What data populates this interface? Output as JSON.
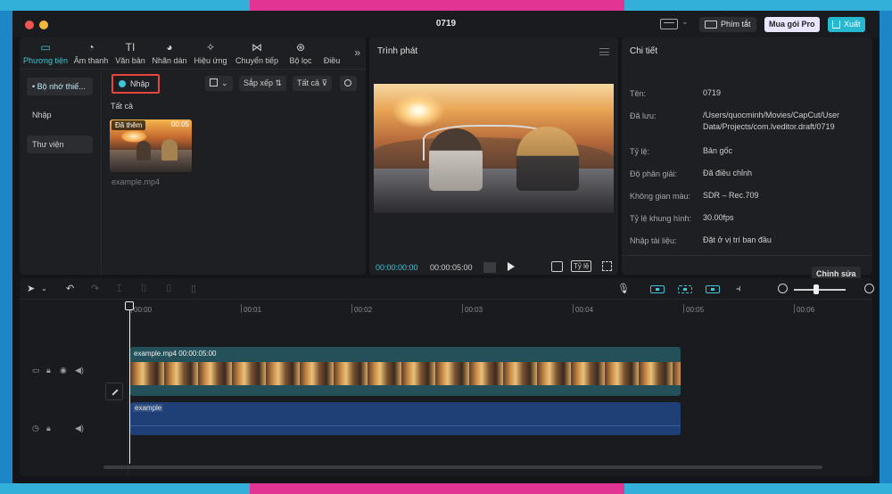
{
  "window": {
    "title": "0719"
  },
  "titlebar": {
    "shortcut_label": "Phím tắt",
    "pro_label": "Mua gói Pro",
    "export_label": "Xuất"
  },
  "media": {
    "tabs": [
      {
        "label": "Phương tiện",
        "icon": "media-icon",
        "glyph": "▭"
      },
      {
        "label": "Âm thanh",
        "icon": "audio-icon",
        "glyph": "◔"
      },
      {
        "label": "Văn bản",
        "icon": "text-icon",
        "glyph": "TI"
      },
      {
        "label": "Nhãn dán",
        "icon": "sticker-icon",
        "glyph": "◕"
      },
      {
        "label": "Hiệu ứng",
        "icon": "effects-icon",
        "glyph": "✧"
      },
      {
        "label": "Chuyển tiếp",
        "icon": "transition-icon",
        "glyph": "⋈"
      },
      {
        "label": "Bộ lọc",
        "icon": "filter-icon",
        "glyph": "⊛"
      },
      {
        "label": "Điều",
        "icon": "adjust-icon",
        "glyph": ""
      }
    ],
    "sidebar": [
      "• Bộ nhớ thiế...",
      "Nhập",
      "Thư viện"
    ],
    "import_label": "Nhập",
    "sort_label": "Sắp xếp",
    "filter_label": "Tất cả",
    "section_label": "Tất cả",
    "clip": {
      "badge": "Đã thêm",
      "duration": "00:05",
      "name": "example.mp4"
    }
  },
  "player": {
    "title": "Trình phát",
    "current_time": "00:00:00:00",
    "total_time": "00:00:05:00",
    "ratio_label": "Tỷ lệ"
  },
  "detail": {
    "title": "Chi tiết",
    "rows": [
      {
        "label": "Tên:",
        "value": "0719"
      },
      {
        "label": "Đã lưu:",
        "value": "/Users/quocminh/Movies/CapCut/User Data/Projects/com.lveditor.draft/0719"
      },
      {
        "label": "Tỷ lệ:",
        "value": "Bản gốc"
      },
      {
        "label": "Độ phân giải:",
        "value": "Đã điều chỉnh"
      },
      {
        "label": "Không gian màu:",
        "value": "SDR – Rec.709"
      },
      {
        "label": "Tỷ lệ khung hình:",
        "value": "30.00fps"
      },
      {
        "label": "Nhập tài liệu:",
        "value": "Đặt ở vị trí ban đầu"
      }
    ],
    "edit_label": "Chỉnh sửa"
  },
  "timeline": {
    "ticks": [
      "00:00",
      "00:01",
      "00:02",
      "00:03",
      "00:04",
      "00:05",
      "00:06"
    ],
    "video_clip_label": "example.mp4  00:00:05:00",
    "audio_clip_label": "example"
  },
  "colors": {
    "accent": "#3fc4d7",
    "highlight_border": "#e8453c",
    "video_track": "#24505a",
    "audio_track": "#1f3f77"
  }
}
